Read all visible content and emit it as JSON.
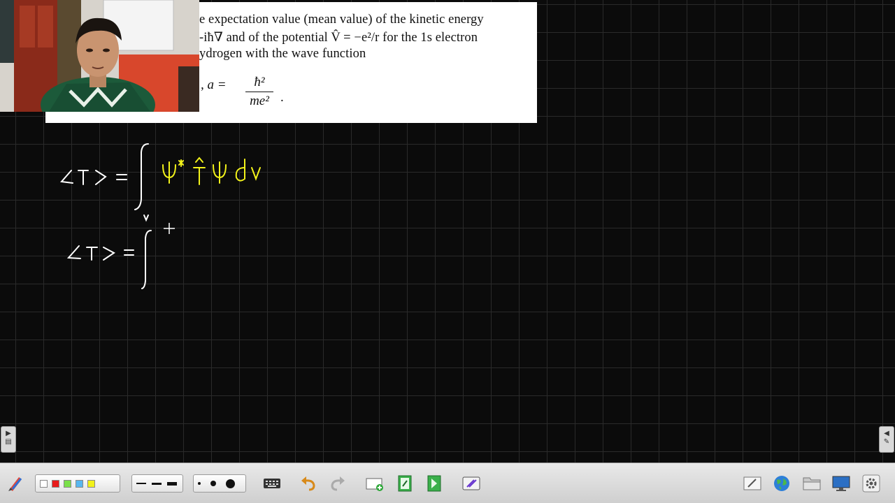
{
  "excerpt": {
    "line1": "e expectation value (mean value) of the kinetic energy",
    "line2": "-iħ∇ and of the potential V̂ = −e²/r for the 1s electron",
    "line3": "ydrogen with the wave function",
    "formula_left": ",    a =",
    "frac_num": "ħ²",
    "frac_den": "me²",
    "frac_end": "."
  },
  "ink": {
    "color_white": "#ffffff",
    "color_yellow": "#f2f21a",
    "eq1_lhs": "⟨T⟩ =",
    "eq1_rhs": "ψ* T̂ ψ dv",
    "eq1_sub": "v",
    "eq2_lhs": "⟨T⟩ ="
  },
  "toolbar": {
    "colors": [
      "#ffffff",
      "#e81c1c",
      "#7be04a",
      "#58b7f0",
      "#f2f21a"
    ],
    "icons": [
      "pen-menu-icon",
      "keyboard-icon",
      "undo-icon",
      "redo-icon",
      "add-page-icon",
      "prev-page-icon",
      "next-page-icon",
      "eraser-icon",
      "edit-icon",
      "globe-icon",
      "folder-icon",
      "screen-icon",
      "settings-icon"
    ]
  }
}
